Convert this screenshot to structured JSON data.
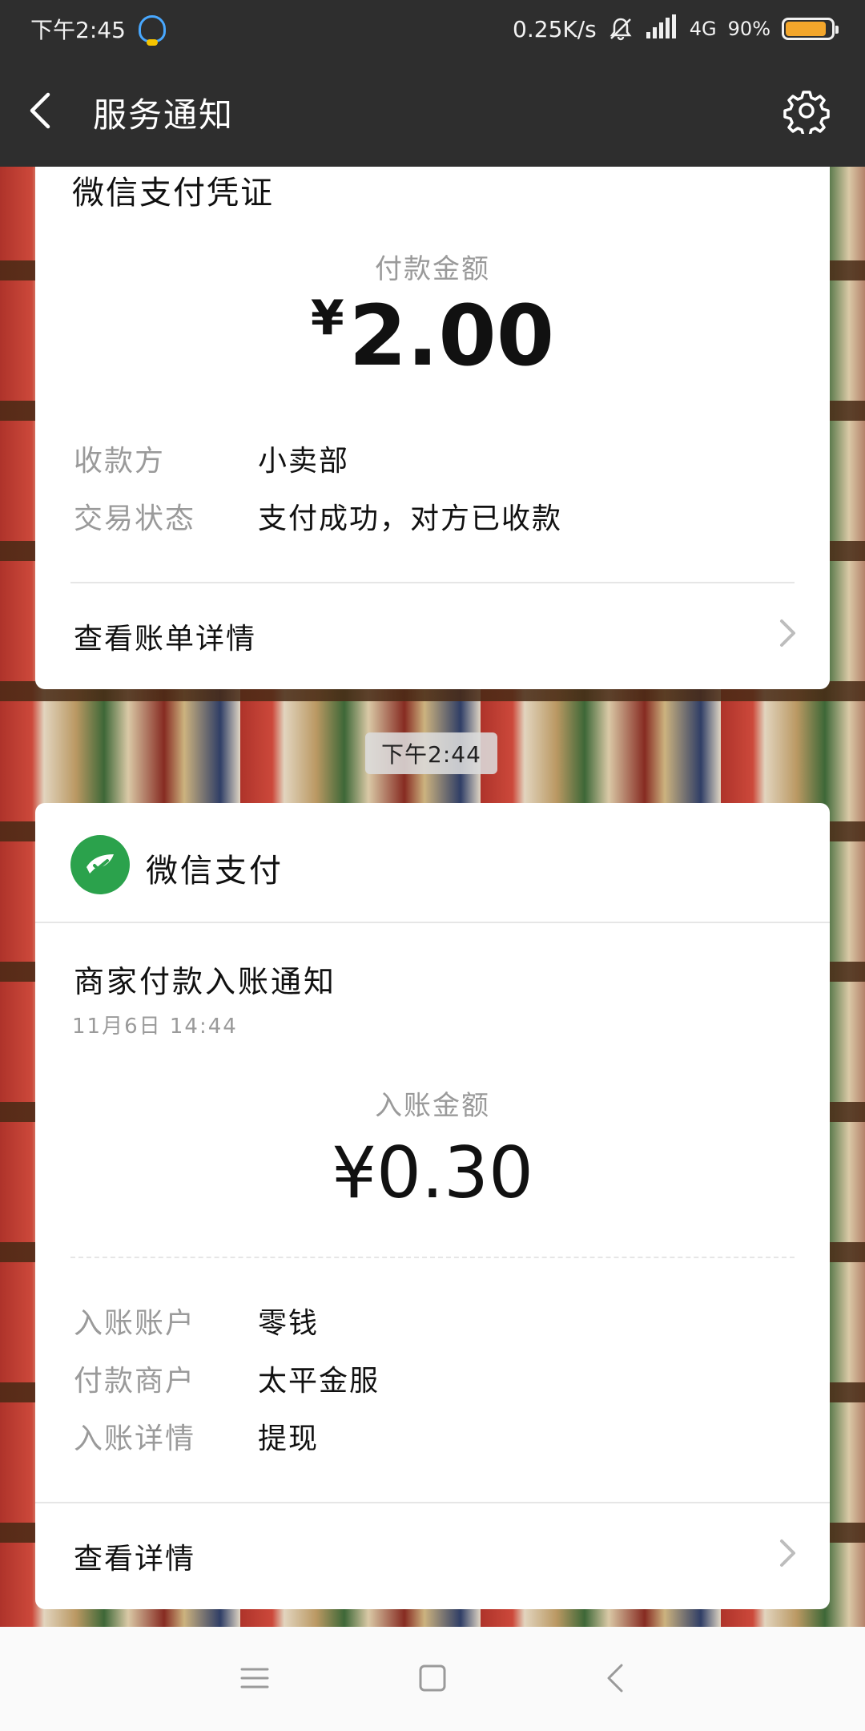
{
  "status_bar": {
    "time": "下午2:45",
    "net_speed": "0.25K/s",
    "network": "4G",
    "battery": "90%"
  },
  "header": {
    "title": "服务通知"
  },
  "card_receipt": {
    "heading": "微信支付凭证",
    "amount_label": "付款金额",
    "currency_symbol": "¥",
    "amount": "2.00",
    "rows": [
      {
        "key": "收款方",
        "value": "小卖部"
      },
      {
        "key": "交易状态",
        "value": "支付成功，对方已收款"
      }
    ],
    "link_label": "查看账单详情"
  },
  "time_divider": "下午2:44",
  "card_notice": {
    "sender": "微信支付",
    "title": "商家付款入账通知",
    "datetime": "11月6日 14:44",
    "amount_label": "入账金额",
    "amount": "¥0.30",
    "rows": [
      {
        "key": "入账账户",
        "value": "零钱"
      },
      {
        "key": "付款商户",
        "value": "太平金服"
      },
      {
        "key": "入账详情",
        "value": "提现"
      }
    ],
    "link_label": "查看详情"
  },
  "colors": {
    "bar_bg": "#2e2e2e",
    "wechat_green": "#2ba24c",
    "battery": "#f3a62b"
  }
}
